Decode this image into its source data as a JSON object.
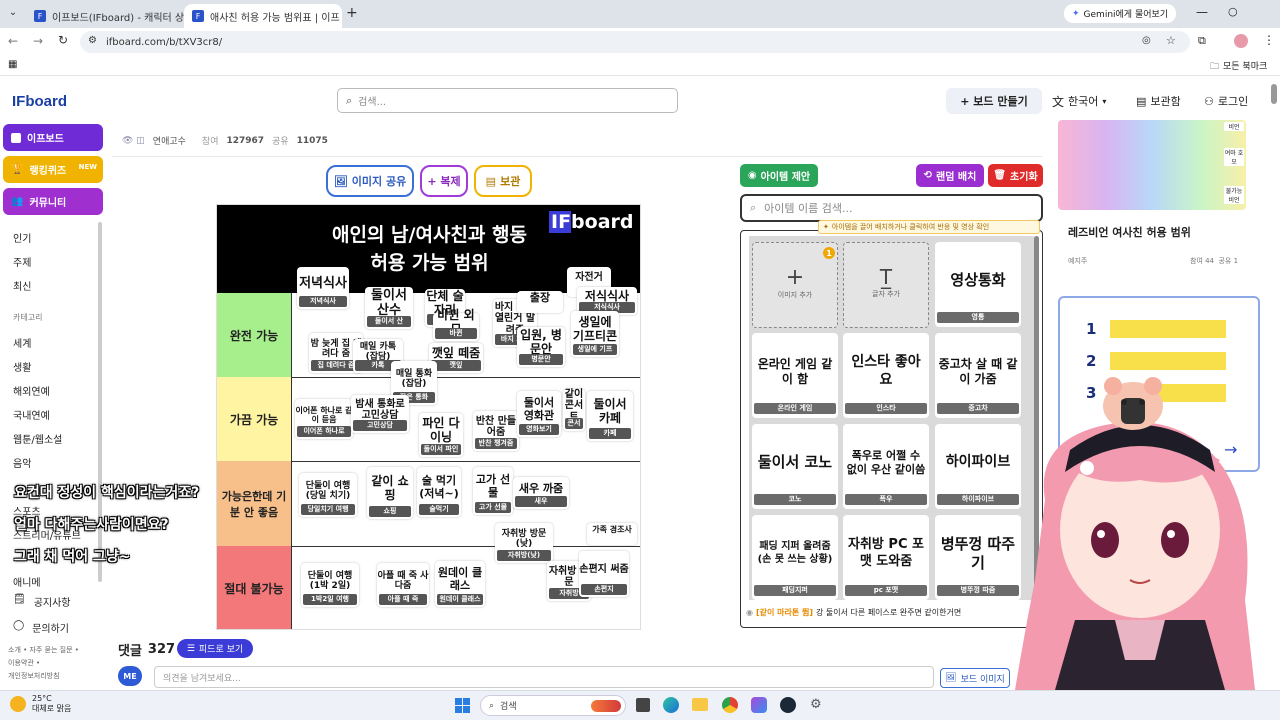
{
  "browser": {
    "tabs": [
      {
        "title": "이프보드(IFboard) - 캐릭터 상"
      },
      {
        "title": "애사친 허용 가능 범위표 | 이프"
      }
    ],
    "gemini_label": "Gemini에게 물어보기",
    "url": "ifboard.com/b/tXV3cr8/",
    "bookmarks_label": "모든 북마크"
  },
  "header": {
    "logo": "IFboard",
    "search_placeholder": "검색...",
    "make_board": "+ 보드 만들기",
    "language": "한국어",
    "vault": "보관함",
    "login": "로그인"
  },
  "board_meta": {
    "author": "연애고수",
    "participants_label": "참여",
    "participants": "127967",
    "shares_label": "공유",
    "shares": "11075"
  },
  "sidebar": {
    "main_buttons": [
      {
        "label": "이프보드",
        "color": "#6f2bd6"
      },
      {
        "label": "랭킹퀴즈",
        "badge": "NEW",
        "color": "#f0b400"
      },
      {
        "label": "커뮤니티",
        "color": "#a02fd0"
      }
    ],
    "sort_items": [
      "인기",
      "주제",
      "최신"
    ],
    "category_heading": "카테고리",
    "categories": [
      "세계",
      "생활",
      "해외연예",
      "국내연예",
      "웹툰/웹소설",
      "음악",
      "스포츠",
      "스트리머/유튜브",
      "애니메"
    ],
    "notice": "공지사항",
    "inquiry": "문의하기",
    "footer": [
      "소개 • 자주 묻는 질문 •",
      "이용약관 •",
      "개인정보처리방침"
    ]
  },
  "actions": {
    "share_image": "이미지 공유",
    "duplicate": "+ 복제",
    "save": "보관"
  },
  "tier_board": {
    "title_line1": "애인의 남/여사친과 행동",
    "title_line2": "허용 가능 범위",
    "watermark": "IFboard",
    "rows": [
      {
        "label": "완전 가능",
        "color": "#a6ef8c"
      },
      {
        "label": "가끔 가능",
        "color": "#fff4a1"
      },
      {
        "label": "가능은한데 기분 안 좋음",
        "color": "#f7c08b"
      },
      {
        "label": "절대 불가능",
        "color": "#f2787a"
      }
    ],
    "cards": [
      {
        "text": "저녁식사",
        "tag": "저녁식사"
      },
      {
        "text": "둘이서 산수",
        "tag": "둘이서 산"
      },
      {
        "text": "단체 술자리",
        "tag": "단체"
      },
      {
        "text": "바뀐 외모",
        "tag": "바뀐"
      },
      {
        "text": "바지 지퍼 열린거 말려줌",
        "tag": "바지 지퍼"
      },
      {
        "text": "출장",
        "tag": ""
      },
      {
        "text": "자전거",
        "tag": ""
      },
      {
        "text": "저식식사",
        "tag": "저식식사"
      },
      {
        "text": "밤 늦게 집 데려다 줌",
        "tag": "집 데려다 줌"
      },
      {
        "text": "매일 카톡 (잡담)",
        "tag": "카톡"
      },
      {
        "text": "깻잎 떼줌",
        "tag": "깻잎"
      },
      {
        "text": "입원, 병문안",
        "tag": "병문안"
      },
      {
        "text": "생일에 기프티콘",
        "tag": "생일에 기프"
      },
      {
        "text": "매일 통화 (잡담)",
        "tag": "잦은 통화"
      },
      {
        "text": "이어폰 하나로 같이 듣음",
        "tag": "이어폰 하나로"
      },
      {
        "text": "밤새 통화로 고민상담",
        "tag": "고민상담"
      },
      {
        "text": "파인 다이닝",
        "tag": "둘이서 파인"
      },
      {
        "text": "반찬 만들어줌",
        "tag": "반찬 챙겨줌"
      },
      {
        "text": "둘이서 영화관",
        "tag": "영화보기"
      },
      {
        "text": "같이 콘서트",
        "tag": "콘서"
      },
      {
        "text": "둘이서 카페",
        "tag": "카페"
      },
      {
        "text": "단둘이 여행 (당일 치기)",
        "tag": "당일치기 여행"
      },
      {
        "text": "같이 쇼핑",
        "tag": "쇼핑"
      },
      {
        "text": "술 먹기 (저녁~)",
        "tag": "술먹기"
      },
      {
        "text": "고가 선물",
        "tag": "고가 선물"
      },
      {
        "text": "새우 까줌",
        "tag": "새우"
      },
      {
        "text": "자취방 방문 (낮)",
        "tag": "자취방(낮)"
      },
      {
        "text": "가족 경조사",
        "tag": ""
      },
      {
        "text": "단둘이 여행 (1박 2일)",
        "tag": "1박2일 여행"
      },
      {
        "text": "아플 때 죽 사다줌",
        "tag": "아플 때 죽"
      },
      {
        "text": "원데이 클래스",
        "tag": "원데이 클래스"
      },
      {
        "text": "자취방 방문",
        "tag": "자취방"
      },
      {
        "text": "손편지 써줌",
        "tag": "손편지"
      }
    ]
  },
  "comments": {
    "label": "댓글",
    "count": "327",
    "feed_button": "피드로 보기",
    "avatar": "ME",
    "placeholder": "의견을 남겨보세요..."
  },
  "item_panel": {
    "suggest_button": "아이템 제안",
    "random_button": "랜덤 배치",
    "reset_button": "초기화",
    "search_placeholder": "아이템 이름 검색...",
    "hint": "아이템을 끌어 배치하거나 클릭하여 반응 및 영상 확인",
    "add_image": "이미지 추가",
    "add_text": "글자 추가",
    "badge": "1",
    "cards": [
      {
        "text": "영상통화",
        "tag": "영통"
      },
      {
        "text": "온라인 게임 같이 함",
        "tag": "온라인 게임"
      },
      {
        "text": "인스타 좋아요",
        "tag": "인스타"
      },
      {
        "text": "중고차 살 때 같이 가줌",
        "tag": "중고차"
      },
      {
        "text": "둘이서 코노",
        "tag": "코노"
      },
      {
        "text": "폭우로 어쩔 수 없이 우산 같이씀",
        "tag": "폭우"
      },
      {
        "text": "하이파이브",
        "tag": "하이파이브"
      },
      {
        "text": "패딩 지퍼 올려줌 (손 못 쓰는 상황)",
        "tag": "패딩지퍼"
      },
      {
        "text": "자취방 PC 포맷 도와줌",
        "tag": "pc 포맷"
      },
      {
        "text": "병뚜껑 따주기",
        "tag": "병뚜껑 따줌"
      }
    ],
    "footer_tag": "[같이 마라톤 뜀]",
    "footer_text": "강 둘이서 다른 페이스로 완주면 같이한거면"
  },
  "right_panel": {
    "card_title": "레즈비언 여사친 허용 범위",
    "card_author": "예지주",
    "card_stats": "참여 44  공유 1",
    "numbers": [
      "1",
      "2",
      "3"
    ],
    "side_notes": [
      "비언",
      "여마 호모",
      "불가능 비언"
    ]
  },
  "board_image_btn": "보드 이미지",
  "subtitles": [
    "요컨대 정성이 핵심이라는거죠?",
    "얼마 다해주는사람이면요?",
    "그래 채 먹어 그냥~"
  ],
  "taskbar": {
    "temp": "25°C",
    "weather": "대체로 맑음",
    "search": "검색"
  }
}
